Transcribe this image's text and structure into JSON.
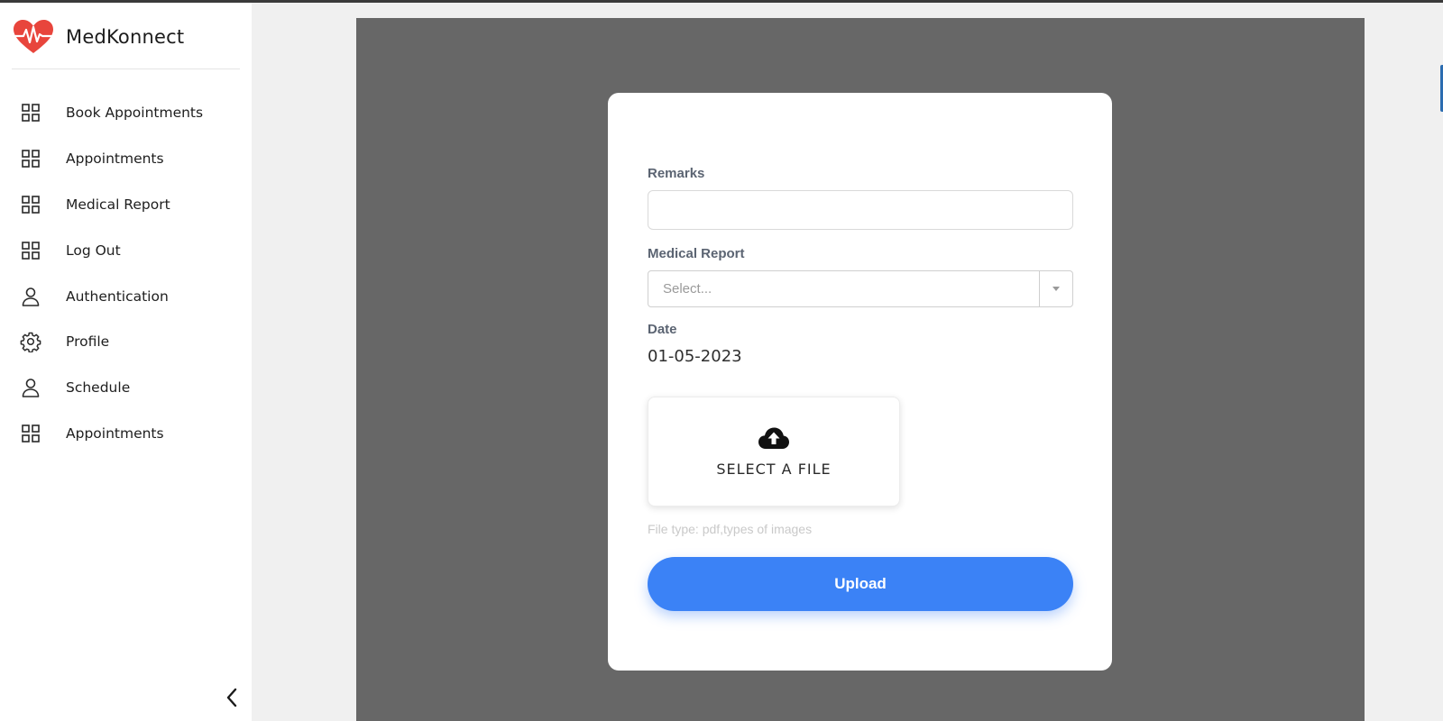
{
  "app": {
    "name": "MedKonnect",
    "logo_icon": "heart-pulse-icon",
    "accent_color": "#e8453c"
  },
  "sidebar": {
    "items": [
      {
        "label": "Book Appointments",
        "icon": "grid-icon"
      },
      {
        "label": "Appointments",
        "icon": "grid-icon"
      },
      {
        "label": "Medical Report",
        "icon": "grid-icon"
      },
      {
        "label": "Log Out",
        "icon": "grid-icon"
      },
      {
        "label": "Authentication",
        "icon": "user-icon"
      },
      {
        "label": "Profile",
        "icon": "gear-icon"
      },
      {
        "label": "Schedule",
        "icon": "user-icon"
      },
      {
        "label": "Appointments",
        "icon": "grid-icon"
      }
    ],
    "collapse_icon": "chevron-left-icon"
  },
  "form": {
    "remarks_label": "Remarks",
    "remarks_value": "",
    "medical_report_label": "Medical Report",
    "medical_report_placeholder": "Select...",
    "date_label": "Date",
    "date_value": "01-05-2023",
    "file_button_label": "SELECT A FILE",
    "file_icon": "cloud-upload-icon",
    "file_hint": "File type: pdf,types of images",
    "upload_label": "Upload",
    "upload_color": "#3b82f6"
  }
}
